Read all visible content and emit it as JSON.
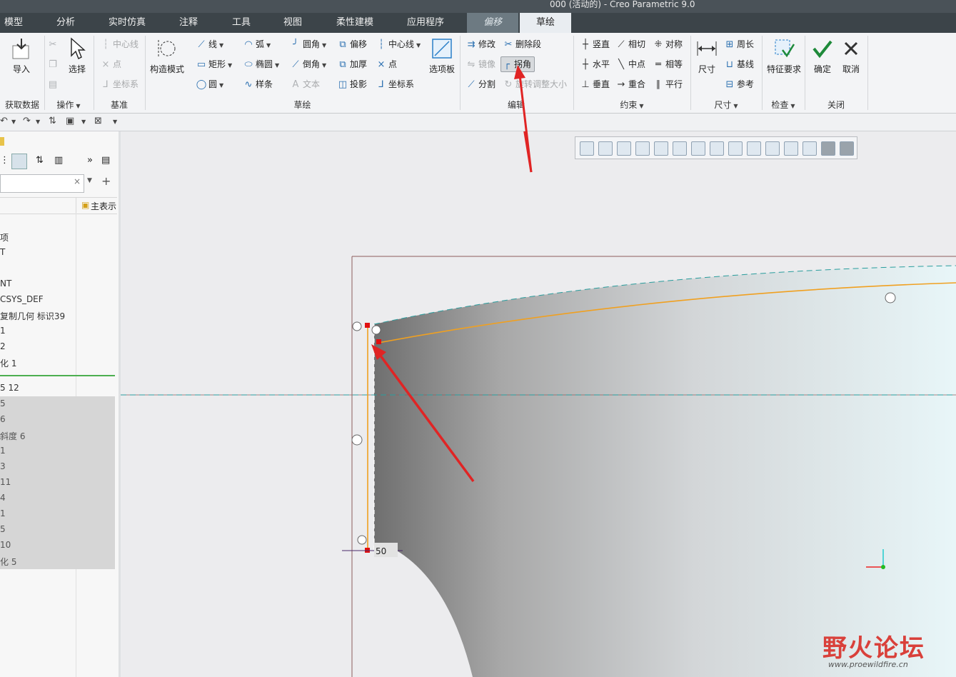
{
  "window": {
    "title": "000 (活动的) - Creo Parametric 9.0"
  },
  "tabs": [
    {
      "label": "模型"
    },
    {
      "label": "分析"
    },
    {
      "label": "实时仿真"
    },
    {
      "label": "注释"
    },
    {
      "label": "工具"
    },
    {
      "label": "视图"
    },
    {
      "label": "柔性建模"
    },
    {
      "label": "应用程序"
    },
    {
      "label": "偏移"
    },
    {
      "label": "草绘"
    }
  ],
  "ribbon": {
    "get_data": {
      "import": "导入",
      "group": "获取数据"
    },
    "operations": {
      "select": "选择",
      "group": "操作"
    },
    "datum": {
      "centerline": "中心线",
      "point": "点",
      "csys": "坐标系",
      "group": "基准"
    },
    "sketch": {
      "construction_mode": "构造模式",
      "line": "线",
      "arc": "弧",
      "fillet": "圆角",
      "offset": "偏移",
      "centerline": "中心线",
      "rectangle": "矩形",
      "ellipse": "椭圆",
      "chamfer": "倒角",
      "thicken": "加厚",
      "point": "点",
      "circle": "圆",
      "spline": "样条",
      "text": "文本",
      "project": "投影",
      "csys": "坐标系",
      "palette": "选项板",
      "group": "草绘"
    },
    "edit": {
      "modify": "修改",
      "delete_segment": "删除段",
      "mirror": "镜像",
      "corner": "拐角",
      "divide": "分割",
      "rotate_resize": "旋转调整大小",
      "group": "编辑"
    },
    "constrain": {
      "vertical": "竖直",
      "tangent": "相切",
      "symmetric": "对称",
      "horizontal": "水平",
      "midpoint": "中点",
      "equal": "相等",
      "perpendicular": "垂直",
      "coincident": "重合",
      "parallel": "平行",
      "group": "约束"
    },
    "dimension": {
      "dimension": "尺寸",
      "perimeter": "周长",
      "baseline": "基线",
      "reference": "参考",
      "group": "尺寸"
    },
    "inspect": {
      "feature_requirements": "特征要求",
      "group": "检查"
    },
    "close": {
      "ok": "确定",
      "cancel": "取消",
      "group": "关闭"
    }
  },
  "left_panel": {
    "show_label": "主表示",
    "tree": [
      "项",
      "T",
      "NT",
      "CSYS_DEF",
      "复制几何 标识39",
      "1",
      "2",
      "化 1"
    ],
    "tree_grey": [
      "5 12",
      "5",
      "6",
      "斜度 6",
      "1",
      "3",
      "11",
      "4",
      "1",
      "5",
      "10",
      "化 5"
    ]
  },
  "sketch": {
    "dimension_value": "50"
  },
  "watermark": {
    "text": "野火论坛",
    "url": "www.proewildfire.cn"
  }
}
